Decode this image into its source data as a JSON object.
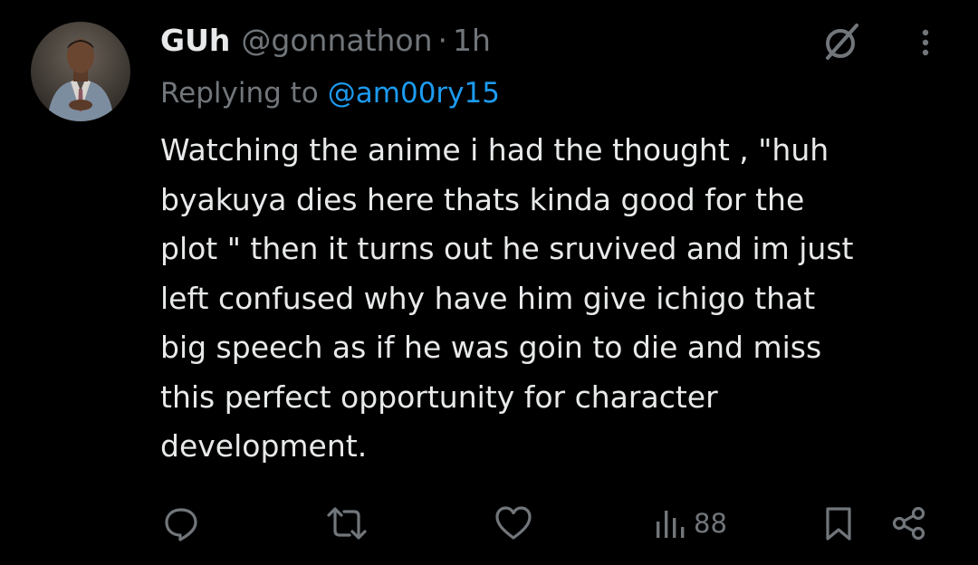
{
  "tweet": {
    "author": {
      "display_name": "GUh",
      "handle": "@gonnathon",
      "separator": "·",
      "time": "1h"
    },
    "replying": {
      "label": "Replying to",
      "target": "@am00ry15"
    },
    "text_lines": [
      "Watching the anime i had the thought , \"huh",
      "byakuya dies here thats kinda good for the",
      "plot \" then it turns out he sruvived and im just",
      "left confused why have him give ichigo that",
      "big speech as if he was goin to die and miss",
      "this perfect opportunity for character",
      "development."
    ],
    "actions": {
      "reply_icon": "reply-icon",
      "retweet_icon": "retweet-icon",
      "like_icon": "heart-icon",
      "views_icon": "views-icon",
      "views_count": "88",
      "bookmark_icon": "bookmark-icon",
      "share_icon": "share-icon"
    },
    "header_icons": {
      "grok_icon": "grok-icon",
      "more_icon": "more-vertical-icon"
    }
  },
  "colors": {
    "background": "#000000",
    "primary_text": "#e7e9ea",
    "secondary_text": "#71767b",
    "accent": "#1d9bf0"
  }
}
